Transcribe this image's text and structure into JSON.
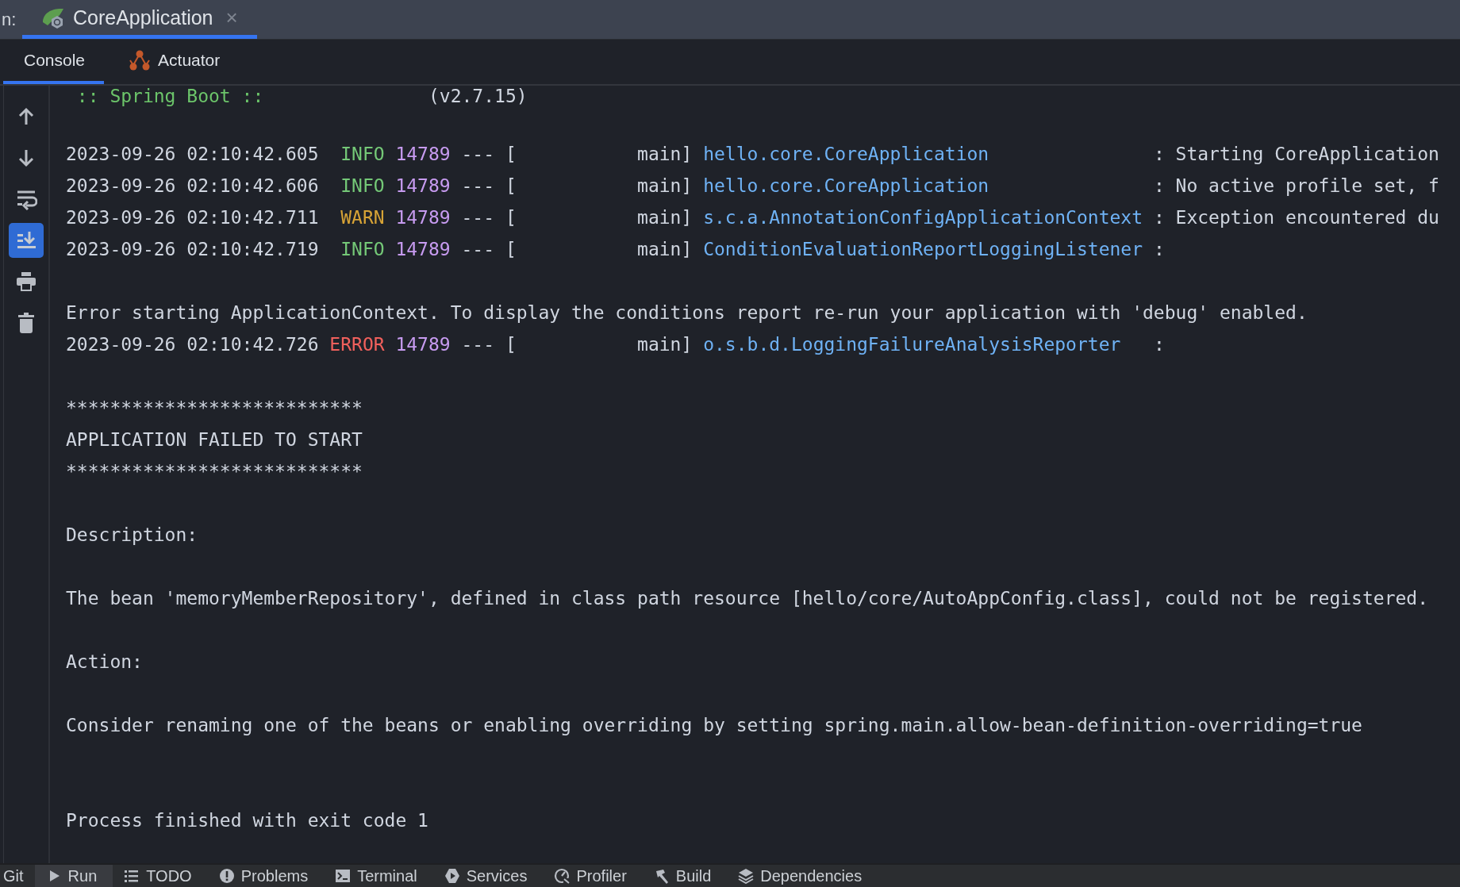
{
  "run_bar": {
    "label": "n:",
    "tabs": [
      {
        "label": "CoreApplication",
        "selected": true,
        "close": "×"
      }
    ]
  },
  "console_tabs": [
    {
      "label": "Console",
      "kind": "console",
      "selected": true
    },
    {
      "label": "Actuator",
      "kind": "actuator",
      "selected": false
    }
  ],
  "toolbar": [
    {
      "kind": "up",
      "on": false
    },
    {
      "kind": "down",
      "on": false
    },
    {
      "kind": "wrap",
      "on": false
    },
    {
      "kind": "scroll-end",
      "on": true
    },
    {
      "kind": "print",
      "on": false
    },
    {
      "kind": "trash",
      "on": false
    }
  ],
  "console_lines": [
    {
      "kind": "banner",
      "text": ":: Spring Boot ::",
      "version": "(v2.7.15)"
    },
    {
      "kind": "blank"
    },
    {
      "kind": "log",
      "time": "2023-09-26 02:10:42.605",
      "level": "INFO",
      "pid": "14789",
      "sep": "---",
      "thread": "[           main]",
      "logger": "hello.core.CoreApplication",
      "colon": ":",
      "message": "Starting CoreApplication"
    },
    {
      "kind": "log",
      "time": "2023-09-26 02:10:42.606",
      "level": "INFO",
      "pid": "14789",
      "sep": "---",
      "thread": "[           main]",
      "logger": "hello.core.CoreApplication",
      "colon": ":",
      "message": "No active profile set, f"
    },
    {
      "kind": "log",
      "time": "2023-09-26 02:10:42.711",
      "level": "WARN",
      "pid": "14789",
      "sep": "---",
      "thread": "[           main]",
      "logger": "s.c.a.AnnotationConfigApplicationContext",
      "colon": ":",
      "message": "Exception encountered du"
    },
    {
      "kind": "log",
      "time": "2023-09-26 02:10:42.719",
      "level": "INFO",
      "pid": "14789",
      "sep": "---",
      "thread": "[           main]",
      "logger": "ConditionEvaluationReportLoggingListener",
      "colon": ":"
    },
    {
      "kind": "blank"
    },
    {
      "kind": "text",
      "text": "Error starting ApplicationContext. To display the conditions report re-run your application with 'debug' enabled."
    },
    {
      "kind": "log",
      "time": "2023-09-26 02:10:42.726",
      "level": "ERROR",
      "pid": "14789",
      "sep": "---",
      "thread": "[           main]",
      "logger": "o.s.b.d.LoggingFailureAnalysisReporter",
      "colon": ":"
    },
    {
      "kind": "blank"
    },
    {
      "kind": "text",
      "text": "***************************"
    },
    {
      "kind": "text",
      "text": "APPLICATION FAILED TO START"
    },
    {
      "kind": "text",
      "text": "***************************"
    },
    {
      "kind": "blank"
    },
    {
      "kind": "text",
      "text": "Description:"
    },
    {
      "kind": "blank"
    },
    {
      "kind": "text",
      "text": "The bean 'memoryMemberRepository', defined in class path resource [hello/core/AutoAppConfig.class], could not be registered."
    },
    {
      "kind": "blank"
    },
    {
      "kind": "text",
      "text": "Action:"
    },
    {
      "kind": "blank"
    },
    {
      "kind": "text",
      "text": "Consider renaming one of the beans or enabling overriding by setting spring.main.allow-bean-definition-overriding=true"
    },
    {
      "kind": "blank"
    },
    {
      "kind": "blank"
    },
    {
      "kind": "text",
      "text": "Process finished with exit code 1"
    }
  ],
  "bottom_tabs": [
    {
      "label": "Git",
      "kind": "none",
      "selected": false
    },
    {
      "label": "Run",
      "kind": "run",
      "selected": true
    },
    {
      "label": "TODO",
      "kind": "list",
      "selected": false
    },
    {
      "label": "Problems",
      "kind": "problems",
      "selected": false
    },
    {
      "label": "Terminal",
      "kind": "terminal",
      "selected": false
    },
    {
      "label": "Services",
      "kind": "services",
      "selected": false
    },
    {
      "label": "Profiler",
      "kind": "profiler",
      "selected": false
    },
    {
      "label": "Build",
      "kind": "build",
      "selected": false
    },
    {
      "label": "Dependencies",
      "kind": "layers",
      "selected": false
    }
  ]
}
